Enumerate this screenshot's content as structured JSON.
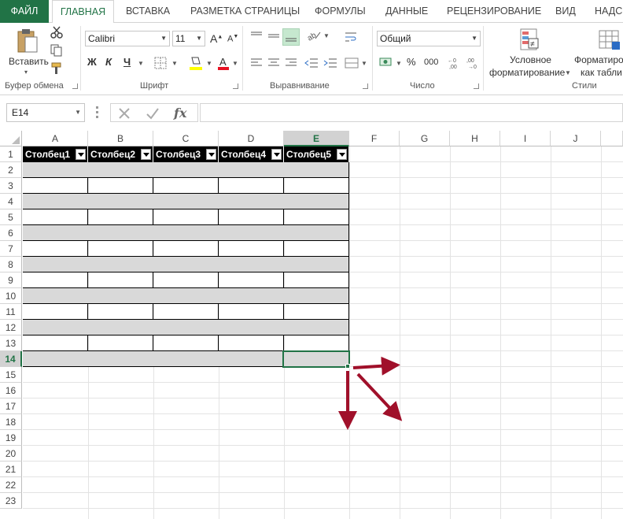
{
  "tabs": [
    "ФАЙЛ",
    "ГЛАВНАЯ",
    "ВСТАВКА",
    "РАЗМЕТКА СТРАНИЦЫ",
    "ФОРМУЛЫ",
    "ДАННЫЕ",
    "РЕЦЕНЗИРОВАНИЕ",
    "ВИД",
    "НАДС"
  ],
  "ribbon": {
    "clipboard": {
      "paste_label": "Вставить",
      "paste_arrow": "▾",
      "group": "Буфер обмена"
    },
    "font": {
      "name": "Calibri",
      "size": "11",
      "bold": "Ж",
      "italic": "К",
      "underline": "Ч",
      "group": "Шрифт"
    },
    "alignment": {
      "group": "Выравнивание"
    },
    "number": {
      "format": "Общий",
      "percent": "%",
      "thousands": "000",
      "group": "Число"
    },
    "styles": {
      "conditional_line1": "Условное",
      "conditional_line2": "форматирование",
      "table_line1": "Форматиро",
      "table_line2": "как табли",
      "group": "Стили"
    }
  },
  "formula_bar": {
    "name_box": "E14",
    "fx": "fx",
    "value": ""
  },
  "grid": {
    "columns": [
      "A",
      "B",
      "C",
      "D",
      "E",
      "F",
      "G",
      "H",
      "I",
      "J"
    ],
    "rows": [
      "1",
      "2",
      "3",
      "4",
      "5",
      "6",
      "7",
      "8",
      "9",
      "10",
      "11",
      "12",
      "13",
      "14",
      "15",
      "16",
      "17",
      "18",
      "19",
      "20",
      "21",
      "22",
      "23"
    ],
    "selected_column": "E",
    "selected_row": "14",
    "table_headers": [
      "Столбец1",
      "Столбец2",
      "Столбец3",
      "Столбец4",
      "Столбец5"
    ]
  },
  "colors": {
    "accent": "#217346",
    "arrow": "#a0102a",
    "band": "#d9d9d9"
  }
}
